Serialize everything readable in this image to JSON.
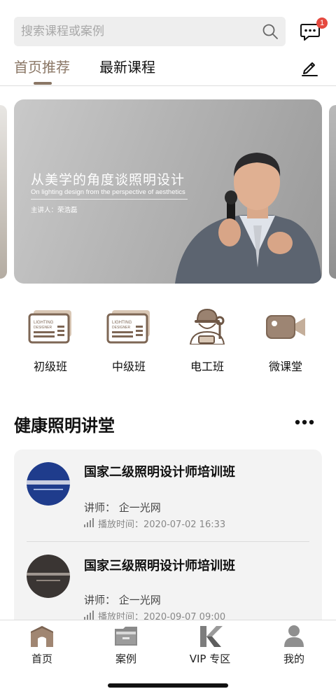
{
  "search": {
    "placeholder": "搜索课程或案例"
  },
  "messages": {
    "badge_count": "1"
  },
  "tabs": [
    {
      "label": "首页推荐",
      "active": true
    },
    {
      "label": "最新课程",
      "active": false
    }
  ],
  "banner": {
    "title": "从美学的角度谈照明设计",
    "subtitle": "On lighting design from the perspective of aesthetics",
    "speaker": "主讲人：荣浩磊"
  },
  "categories": [
    {
      "label": "初级班",
      "icon": "lighting-designer-card-icon"
    },
    {
      "label": "中级班",
      "icon": "lighting-designer-card-icon"
    },
    {
      "label": "电工班",
      "icon": "electrician-icon"
    },
    {
      "label": "微课堂",
      "icon": "video-camera-icon"
    }
  ],
  "section": {
    "title": "健康照明讲堂"
  },
  "courses": [
    {
      "title": "国家二级照明设计师培训班",
      "teacher": "讲师：  企一光网",
      "playtime": "播放时间：2020-07-02 16:33",
      "cover_color": "#1f3c8c"
    },
    {
      "title": "国家三级照明设计师培训班",
      "teacher": "讲师：  企一光网",
      "playtime": "播放时间：2020-09-07 09:00",
      "cover_color": "#3a3533"
    }
  ],
  "tabbar": [
    {
      "label": "首页",
      "icon": "home-icon"
    },
    {
      "label": "案例",
      "icon": "folder-icon"
    },
    {
      "label": "VIP 专区",
      "icon": "vip-k-icon"
    },
    {
      "label": "我的",
      "icon": "profile-icon"
    }
  ],
  "colors": {
    "accent": "#8a7665",
    "badge": "#e5493f",
    "card_bg": "#f3f3f3"
  }
}
